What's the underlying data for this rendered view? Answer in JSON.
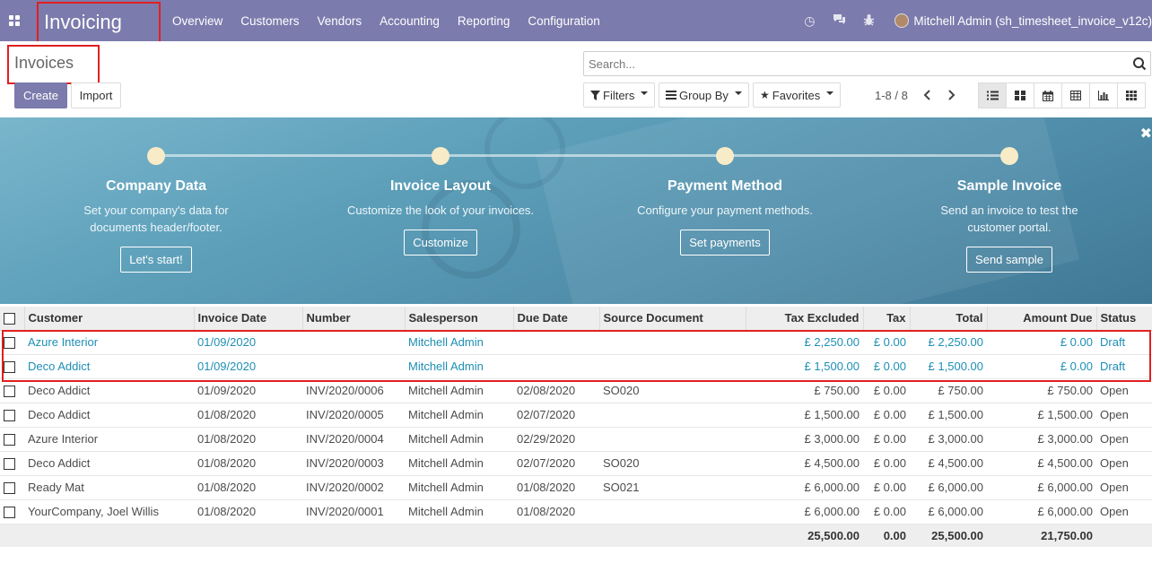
{
  "navbar": {
    "app_title": "Invoicing",
    "menu": [
      "Overview",
      "Customers",
      "Vendors",
      "Accounting",
      "Reporting",
      "Configuration"
    ],
    "user": "Mitchell Admin (sh_timesheet_invoice_v12c)",
    "icons": [
      "clock-icon",
      "chat-icon",
      "bug-icon"
    ]
  },
  "control_panel": {
    "title": "Invoices",
    "create_label": "Create",
    "import_label": "Import",
    "search_placeholder": "Search...",
    "filters_label": "Filters",
    "groupby_label": "Group By",
    "favorites_label": "Favorites",
    "pager": "1-8 / 8"
  },
  "onboarding": {
    "steps": [
      {
        "title": "Company Data",
        "desc1": "Set your company's data for",
        "desc2": "documents header/footer.",
        "button": "Let's start!"
      },
      {
        "title": "Invoice Layout",
        "desc1": "Customize the look of your invoices.",
        "desc2": "",
        "button": "Customize"
      },
      {
        "title": "Payment Method",
        "desc1": "Configure your payment methods.",
        "desc2": "",
        "button": "Set payments"
      },
      {
        "title": "Sample Invoice",
        "desc1": "Send an invoice to test the",
        "desc2": "customer portal.",
        "button": "Send sample"
      }
    ]
  },
  "table": {
    "columns": [
      "Customer",
      "Invoice Date",
      "Number",
      "Salesperson",
      "Due Date",
      "Source Document",
      "Tax Excluded",
      "Tax",
      "Total",
      "Amount Due",
      "Status"
    ],
    "rows": [
      [
        "Azure Interior",
        "01/09/2020",
        "",
        "Mitchell Admin",
        "",
        "",
        "£ 2,250.00",
        "£ 0.00",
        "£ 2,250.00",
        "£ 0.00",
        "Draft"
      ],
      [
        "Deco Addict",
        "01/09/2020",
        "",
        "Mitchell Admin",
        "",
        "",
        "£ 1,500.00",
        "£ 0.00",
        "£ 1,500.00",
        "£ 0.00",
        "Draft"
      ],
      [
        "Deco Addict",
        "01/09/2020",
        "INV/2020/0006",
        "Mitchell Admin",
        "02/08/2020",
        "SO020",
        "£ 750.00",
        "£ 0.00",
        "£ 750.00",
        "£ 750.00",
        "Open"
      ],
      [
        "Deco Addict",
        "01/08/2020",
        "INV/2020/0005",
        "Mitchell Admin",
        "02/07/2020",
        "",
        "£ 1,500.00",
        "£ 0.00",
        "£ 1,500.00",
        "£ 1,500.00",
        "Open"
      ],
      [
        "Azure Interior",
        "01/08/2020",
        "INV/2020/0004",
        "Mitchell Admin",
        "02/29/2020",
        "",
        "£ 3,000.00",
        "£ 0.00",
        "£ 3,000.00",
        "£ 3,000.00",
        "Open"
      ],
      [
        "Deco Addict",
        "01/08/2020",
        "INV/2020/0003",
        "Mitchell Admin",
        "02/07/2020",
        "SO020",
        "£ 4,500.00",
        "£ 0.00",
        "£ 4,500.00",
        "£ 4,500.00",
        "Open"
      ],
      [
        "Ready Mat",
        "01/08/2020",
        "INV/2020/0002",
        "Mitchell Admin",
        "01/08/2020",
        "SO021",
        "£ 6,000.00",
        "£ 0.00",
        "£ 6,000.00",
        "£ 6,000.00",
        "Open"
      ],
      [
        "YourCompany, Joel Willis",
        "01/08/2020",
        "INV/2020/0001",
        "Mitchell Admin",
        "01/08/2020",
        "",
        "£ 6,000.00",
        "£ 0.00",
        "£ 6,000.00",
        "£ 6,000.00",
        "Open"
      ]
    ],
    "totals": {
      "tax_excluded": "25,500.00",
      "tax": "0.00",
      "total": "25,500.00",
      "amount_due": "21,750.00"
    }
  },
  "colors": {
    "brand": "#7c7bad",
    "draft_text": "#1e8fb4",
    "highlight": "#e02020"
  }
}
